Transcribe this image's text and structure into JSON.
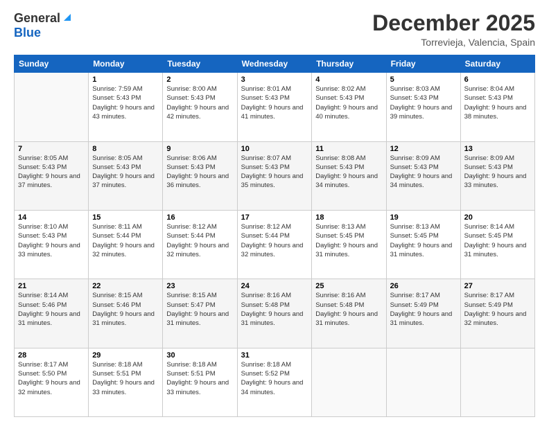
{
  "header": {
    "logo_general": "General",
    "logo_blue": "Blue",
    "month_title": "December 2025",
    "location": "Torrevieja, Valencia, Spain"
  },
  "days_of_week": [
    "Sunday",
    "Monday",
    "Tuesday",
    "Wednesday",
    "Thursday",
    "Friday",
    "Saturday"
  ],
  "weeks": [
    [
      {
        "day": "",
        "sunrise": "",
        "sunset": "",
        "daylight": ""
      },
      {
        "day": "1",
        "sunrise": "Sunrise: 7:59 AM",
        "sunset": "Sunset: 5:43 PM",
        "daylight": "Daylight: 9 hours and 43 minutes."
      },
      {
        "day": "2",
        "sunrise": "Sunrise: 8:00 AM",
        "sunset": "Sunset: 5:43 PM",
        "daylight": "Daylight: 9 hours and 42 minutes."
      },
      {
        "day": "3",
        "sunrise": "Sunrise: 8:01 AM",
        "sunset": "Sunset: 5:43 PM",
        "daylight": "Daylight: 9 hours and 41 minutes."
      },
      {
        "day": "4",
        "sunrise": "Sunrise: 8:02 AM",
        "sunset": "Sunset: 5:43 PM",
        "daylight": "Daylight: 9 hours and 40 minutes."
      },
      {
        "day": "5",
        "sunrise": "Sunrise: 8:03 AM",
        "sunset": "Sunset: 5:43 PM",
        "daylight": "Daylight: 9 hours and 39 minutes."
      },
      {
        "day": "6",
        "sunrise": "Sunrise: 8:04 AM",
        "sunset": "Sunset: 5:43 PM",
        "daylight": "Daylight: 9 hours and 38 minutes."
      }
    ],
    [
      {
        "day": "7",
        "sunrise": "Sunrise: 8:05 AM",
        "sunset": "Sunset: 5:43 PM",
        "daylight": "Daylight: 9 hours and 37 minutes."
      },
      {
        "day": "8",
        "sunrise": "Sunrise: 8:05 AM",
        "sunset": "Sunset: 5:43 PM",
        "daylight": "Daylight: 9 hours and 37 minutes."
      },
      {
        "day": "9",
        "sunrise": "Sunrise: 8:06 AM",
        "sunset": "Sunset: 5:43 PM",
        "daylight": "Daylight: 9 hours and 36 minutes."
      },
      {
        "day": "10",
        "sunrise": "Sunrise: 8:07 AM",
        "sunset": "Sunset: 5:43 PM",
        "daylight": "Daylight: 9 hours and 35 minutes."
      },
      {
        "day": "11",
        "sunrise": "Sunrise: 8:08 AM",
        "sunset": "Sunset: 5:43 PM",
        "daylight": "Daylight: 9 hours and 34 minutes."
      },
      {
        "day": "12",
        "sunrise": "Sunrise: 8:09 AM",
        "sunset": "Sunset: 5:43 PM",
        "daylight": "Daylight: 9 hours and 34 minutes."
      },
      {
        "day": "13",
        "sunrise": "Sunrise: 8:09 AM",
        "sunset": "Sunset: 5:43 PM",
        "daylight": "Daylight: 9 hours and 33 minutes."
      }
    ],
    [
      {
        "day": "14",
        "sunrise": "Sunrise: 8:10 AM",
        "sunset": "Sunset: 5:43 PM",
        "daylight": "Daylight: 9 hours and 33 minutes."
      },
      {
        "day": "15",
        "sunrise": "Sunrise: 8:11 AM",
        "sunset": "Sunset: 5:44 PM",
        "daylight": "Daylight: 9 hours and 32 minutes."
      },
      {
        "day": "16",
        "sunrise": "Sunrise: 8:12 AM",
        "sunset": "Sunset: 5:44 PM",
        "daylight": "Daylight: 9 hours and 32 minutes."
      },
      {
        "day": "17",
        "sunrise": "Sunrise: 8:12 AM",
        "sunset": "Sunset: 5:44 PM",
        "daylight": "Daylight: 9 hours and 32 minutes."
      },
      {
        "day": "18",
        "sunrise": "Sunrise: 8:13 AM",
        "sunset": "Sunset: 5:45 PM",
        "daylight": "Daylight: 9 hours and 31 minutes."
      },
      {
        "day": "19",
        "sunrise": "Sunrise: 8:13 AM",
        "sunset": "Sunset: 5:45 PM",
        "daylight": "Daylight: 9 hours and 31 minutes."
      },
      {
        "day": "20",
        "sunrise": "Sunrise: 8:14 AM",
        "sunset": "Sunset: 5:45 PM",
        "daylight": "Daylight: 9 hours and 31 minutes."
      }
    ],
    [
      {
        "day": "21",
        "sunrise": "Sunrise: 8:14 AM",
        "sunset": "Sunset: 5:46 PM",
        "daylight": "Daylight: 9 hours and 31 minutes."
      },
      {
        "day": "22",
        "sunrise": "Sunrise: 8:15 AM",
        "sunset": "Sunset: 5:46 PM",
        "daylight": "Daylight: 9 hours and 31 minutes."
      },
      {
        "day": "23",
        "sunrise": "Sunrise: 8:15 AM",
        "sunset": "Sunset: 5:47 PM",
        "daylight": "Daylight: 9 hours and 31 minutes."
      },
      {
        "day": "24",
        "sunrise": "Sunrise: 8:16 AM",
        "sunset": "Sunset: 5:48 PM",
        "daylight": "Daylight: 9 hours and 31 minutes."
      },
      {
        "day": "25",
        "sunrise": "Sunrise: 8:16 AM",
        "sunset": "Sunset: 5:48 PM",
        "daylight": "Daylight: 9 hours and 31 minutes."
      },
      {
        "day": "26",
        "sunrise": "Sunrise: 8:17 AM",
        "sunset": "Sunset: 5:49 PM",
        "daylight": "Daylight: 9 hours and 31 minutes."
      },
      {
        "day": "27",
        "sunrise": "Sunrise: 8:17 AM",
        "sunset": "Sunset: 5:49 PM",
        "daylight": "Daylight: 9 hours and 32 minutes."
      }
    ],
    [
      {
        "day": "28",
        "sunrise": "Sunrise: 8:17 AM",
        "sunset": "Sunset: 5:50 PM",
        "daylight": "Daylight: 9 hours and 32 minutes."
      },
      {
        "day": "29",
        "sunrise": "Sunrise: 8:18 AM",
        "sunset": "Sunset: 5:51 PM",
        "daylight": "Daylight: 9 hours and 33 minutes."
      },
      {
        "day": "30",
        "sunrise": "Sunrise: 8:18 AM",
        "sunset": "Sunset: 5:51 PM",
        "daylight": "Daylight: 9 hours and 33 minutes."
      },
      {
        "day": "31",
        "sunrise": "Sunrise: 8:18 AM",
        "sunset": "Sunset: 5:52 PM",
        "daylight": "Daylight: 9 hours and 34 minutes."
      },
      {
        "day": "",
        "sunrise": "",
        "sunset": "",
        "daylight": ""
      },
      {
        "day": "",
        "sunrise": "",
        "sunset": "",
        "daylight": ""
      },
      {
        "day": "",
        "sunrise": "",
        "sunset": "",
        "daylight": ""
      }
    ]
  ]
}
